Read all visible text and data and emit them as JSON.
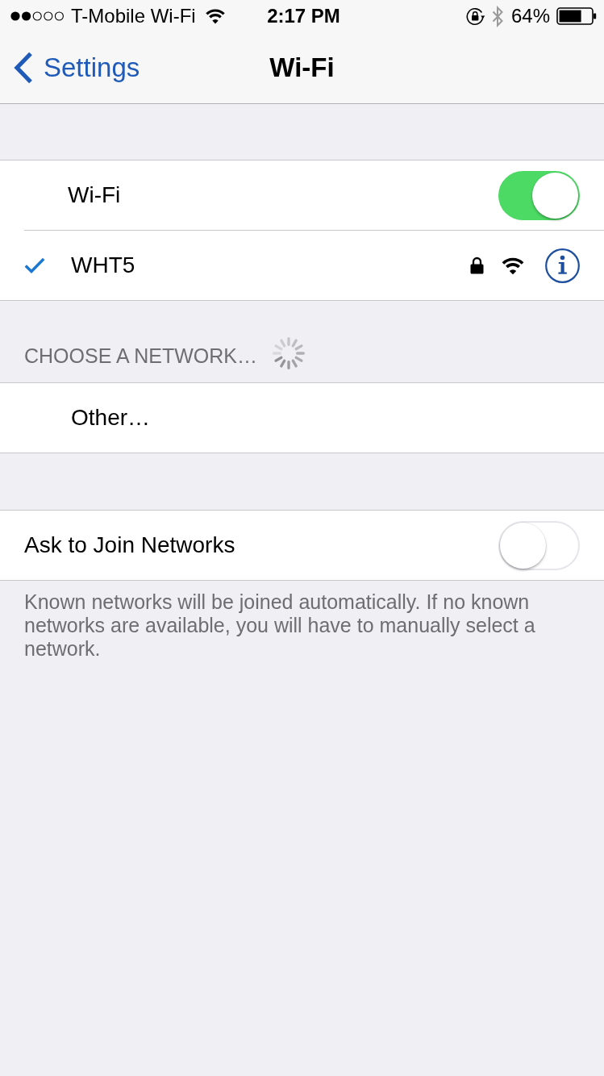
{
  "status_bar": {
    "carrier": "T-Mobile Wi-Fi",
    "time": "2:17 PM",
    "battery": "64%"
  },
  "nav_bar": {
    "back": "Settings",
    "title": "Wi-Fi"
  },
  "wifi": {
    "toggle": {
      "label": "Wi-Fi",
      "on": true
    },
    "connected_network": {
      "name": "WHT5",
      "selected": true,
      "secured": true
    }
  },
  "network_list": {
    "header": "CHOOSE A NETWORK…",
    "scanning": true,
    "items": [
      {
        "name": "Other…"
      }
    ]
  },
  "ask_to_join": {
    "label": "Ask to Join Networks",
    "on": false
  },
  "footer": "Known networks will be joined automatically. If no known networks are available, you will have to manually select a network."
}
